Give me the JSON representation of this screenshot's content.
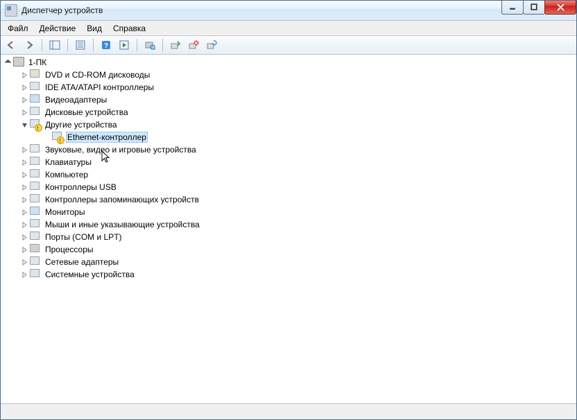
{
  "window": {
    "title": "Диспетчер устройств"
  },
  "menu": {
    "file": "Файл",
    "action": "Действие",
    "view": "Вид",
    "help": "Справка"
  },
  "tree": {
    "root": "1-ПК",
    "dvd": "DVD и CD-ROM дисководы",
    "ide": "IDE ATA/ATAPI контроллеры",
    "video": "Видеоадаптеры",
    "disk": "Дисковые устройства",
    "other": "Другие устройства",
    "ethernet": "Ethernet-контроллер",
    "sound": "Звуковые, видео и игровые устройства",
    "keyboard": "Клавиатуры",
    "computer": "Компьютер",
    "usb": "Контроллеры USB",
    "storage": "Контроллеры запоминающих устройств",
    "monitor": "Мониторы",
    "mouse": "Мыши и иные указывающие устройства",
    "ports": "Порты (COM и LPT)",
    "cpu": "Процессоры",
    "net": "Сетевые адаптеры",
    "system": "Системные устройства"
  }
}
